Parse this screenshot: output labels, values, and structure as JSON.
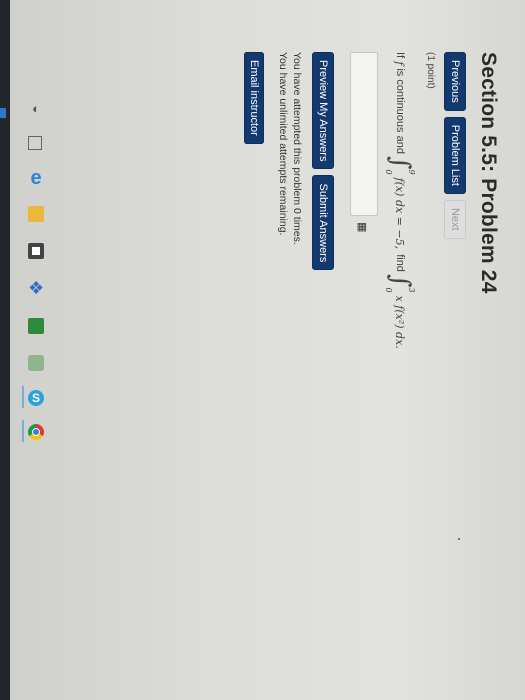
{
  "page": {
    "title": "Section 5.5: Problem 24",
    "nav": {
      "previous": "Previous",
      "problem_list": "Problem List",
      "next": "Next"
    },
    "points": "(1 point)",
    "problem": {
      "lead": "If",
      "f": "f",
      "lead2": "is continuous and",
      "int1": {
        "upper": "9",
        "lower": "0",
        "integrand": "f(x) dx = −5,",
        "symbol": "∫"
      },
      "find": "find",
      "int2": {
        "upper": "3",
        "lower": "0",
        "integrand": "x f(x²) dx.",
        "symbol": "∫"
      }
    },
    "answer_value": "",
    "grid_icon": "▦",
    "actions": {
      "preview": "Preview My Answers",
      "submit": "Submit Answers"
    },
    "messages": {
      "attempts": "You have attempted this problem 0 times.",
      "remaining": "You have unlimited attempts remaining."
    },
    "email": "Email instructor"
  },
  "taskbar": {
    "icons": [
      "back-icon",
      "task-view-icon",
      "edge-icon",
      "file-explorer-icon",
      "store-icon",
      "dropbox-icon",
      "sheets-icon",
      "game-icon",
      "skype-icon",
      "chrome-icon"
    ],
    "glyphs": {
      "back": "◐",
      "task": "▢",
      "edge": "e",
      "dropbox": "❖",
      "skype": "S"
    },
    "accent": "#2f78c4",
    "button_color": "#123a6e"
  }
}
